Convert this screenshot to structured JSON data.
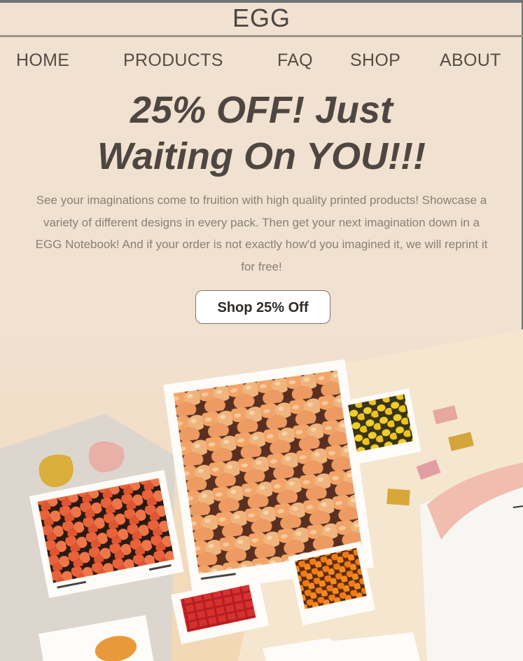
{
  "header": {
    "logo": "EGG"
  },
  "nav": {
    "items": [
      {
        "label": "HOME"
      },
      {
        "label": "PRODUCTS"
      },
      {
        "label": "FAQ"
      },
      {
        "label": "SHOP"
      },
      {
        "label": "ABOUT"
      }
    ]
  },
  "hero": {
    "headline_line1": "25% OFF! Just",
    "headline_line2": "Waiting On YOU!!!",
    "body_lines": [
      "See your imaginations come to fruition with high quality printed products! Showcase a",
      "variety of different designs in every pack. Then get your next imagination down in a",
      "EGG Notebook! And if your order is not exactly how'd you imagined it, we will reprint it",
      "for free!"
    ],
    "cta_label": "Shop 25% Off",
    "image_alt": "Assorted printed photo prints of fruit laid out on a beige surface"
  },
  "colors": {
    "page_bg": "#f1e1d0",
    "text": "#544c45",
    "muted_text": "#8b7f75",
    "border": "#9b928a",
    "accent_top": "#6d7676"
  }
}
